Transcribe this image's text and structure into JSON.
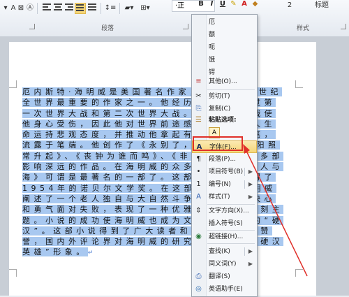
{
  "ribbon": {
    "format_painter": "◆",
    "bold": "B",
    "italic": "I",
    "underline": "U",
    "font_color": "A",
    "paragraph_group": "段落",
    "styles_group": "样式",
    "style_normal": "·正",
    "style_heading2": "2",
    "style_title": "标题"
  },
  "document": {
    "paragraph": "厄内斯特·海明威是美国著名作家，被认为二十世纪全世界最重要的作家之一。他经历曲折，参加过第一次世界大战和第二次世界大战。两次世界大战使他身心受伤，因此他对世界前途感到失望，对人生命运持悲观态度，并推动他拿起有力的文学之笔，流露于笔端。他创作了《永别了，武器》、《太阳照常升起》、《丧钟为谁而鸣》、《非洲的青山》等多部影响深远的作品。在海明威的众多作品中，《老人与海》可谓是最著名的一部了。这部借该小说获得了1954年的诺贝尔文学奖。在这部小说中，海明威阐述了一个老人独自与大自然斗争、以极大的决心和勇气面对失败，表现了一种优雅地生存”等深刻主题。小说的成功使海明威也成为文学史上著名的“硬汉”。这部小说得到了广大读者和评论界的高度赞誉，国内外评论界对海明威的研究最多的就是“硬汉英雄”形象。",
    "paragraph_mark": "↵"
  },
  "context_menu": {
    "recent_fonts": [
      "厄",
      "额",
      "呃",
      "饿",
      "锷"
    ],
    "items": [
      {
        "label": "其他(O)...",
        "icon": "≡"
      },
      {
        "label": "剪切(T)",
        "icon": "✂"
      },
      {
        "label": "复制(C)",
        "icon": "⎘"
      },
      {
        "label": "粘贴选项:",
        "icon": "☰"
      },
      {
        "label": "字体(F)...",
        "icon": "A"
      },
      {
        "label": "段落(P)...",
        "icon": "¶"
      },
      {
        "label": "项目符号(B)",
        "icon": "•"
      },
      {
        "label": "编号(N)",
        "icon": "1"
      },
      {
        "label": "样式(T)",
        "icon": "A"
      },
      {
        "label": "文字方向(X)...",
        "icon": "⇕"
      },
      {
        "label": "插入符号(S)",
        "icon": ""
      },
      {
        "label": "超链接(H)...",
        "icon": "◉"
      },
      {
        "label": "查找(K)",
        "icon": ""
      },
      {
        "label": "同义词(Y)",
        "icon": ""
      },
      {
        "label": "翻译(S)",
        "icon": "⎙"
      },
      {
        "label": "英语助手(E)",
        "icon": "◎"
      }
    ]
  },
  "colors": {
    "highlight": "#f5d77a",
    "annotation": "#e0302a",
    "selection": "#a8c8f0"
  }
}
